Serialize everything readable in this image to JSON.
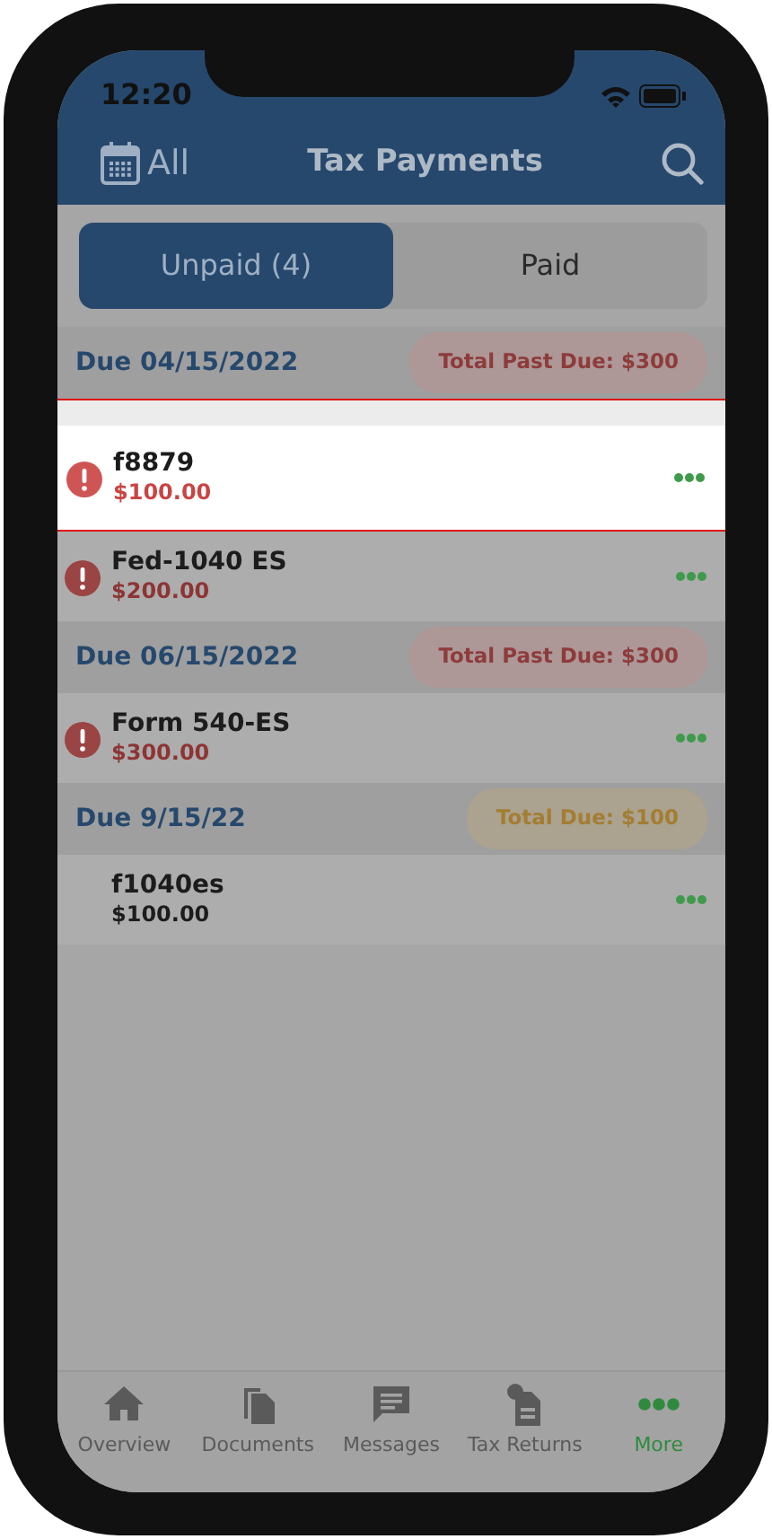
{
  "status_bar": {
    "time": "12:20"
  },
  "header": {
    "filter_label": "All",
    "title": "Tax Payments"
  },
  "segments": [
    {
      "label": "Unpaid (4)",
      "selected": true
    },
    {
      "label": "Paid",
      "selected": false
    }
  ],
  "groups": [
    {
      "due": "Due 04/15/2022",
      "total": {
        "text": "Total Past Due: $300",
        "kind": "past_due"
      },
      "items": [
        {
          "name": "f8879",
          "amount": "$100.00",
          "overdue": true,
          "highlighted": true
        },
        {
          "name": "Fed-1040 ES",
          "amount": "$200.00",
          "overdue": true,
          "highlighted": false
        }
      ]
    },
    {
      "due": "Due 06/15/2022",
      "total": {
        "text": "Total Past Due: $300",
        "kind": "past_due"
      },
      "items": [
        {
          "name": "Form 540-ES",
          "amount": "$300.00",
          "overdue": true,
          "highlighted": false
        }
      ]
    },
    {
      "due": "Due 9/15/22",
      "total": {
        "text": "Total Due: $100",
        "kind": "due"
      },
      "items": [
        {
          "name": "f1040es",
          "amount": "$100.00",
          "overdue": false,
          "highlighted": false
        }
      ]
    }
  ],
  "tab_bar": [
    {
      "label": "Overview",
      "kind": "home",
      "selected": false
    },
    {
      "label": "Documents",
      "kind": "documents",
      "selected": false
    },
    {
      "label": "Messages",
      "kind": "messages",
      "selected": false
    },
    {
      "label": "Tax Returns",
      "kind": "returns",
      "selected": false
    },
    {
      "label": "More",
      "kind": "more",
      "selected": true
    }
  ]
}
